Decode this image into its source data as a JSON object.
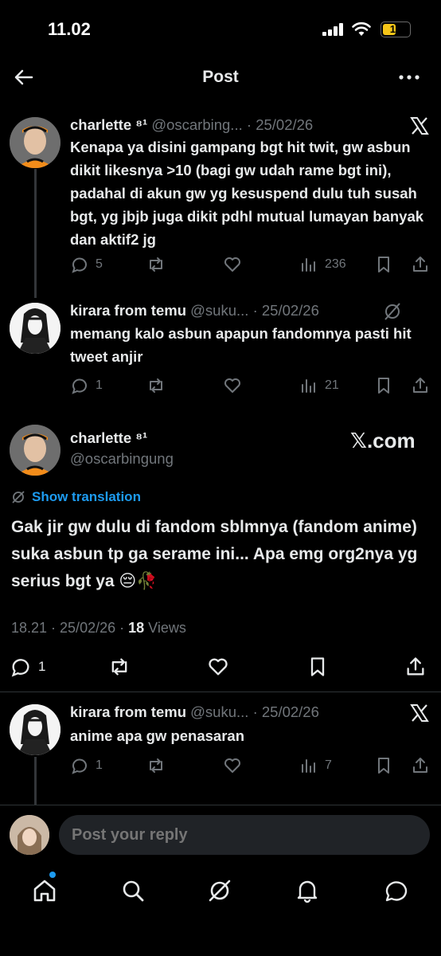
{
  "status_bar": {
    "time": "11.02",
    "battery": "15",
    "battery_color": "#f5c518"
  },
  "header": {
    "title": "Post"
  },
  "colors": {
    "accent": "#1d9bf0",
    "secondary_text": "#71767b",
    "background": "#000000"
  },
  "posts": [
    {
      "name": "charlette ⁸¹",
      "handle": "@oscarbing...",
      "dot": "·",
      "date": "25/02/26",
      "text": "Kenapa ya disini gampang bgt hit twit, gw asbun dikit likesnya >10 (bagi gw udah rame bgt ini), padahal di akun gw yg kesuspend dulu tuh susah bgt, yg jbjb juga dikit pdhl mutual lumayan banyak dan aktif2 jg",
      "replies": "5",
      "views": "236"
    },
    {
      "name": "kirara from temu",
      "handle": "@suku...",
      "dot": "·",
      "date": "25/02/26",
      "text": "memang kalo asbun apapun fandomnya pasti hit tweet anjir",
      "replies": "1",
      "views": "21"
    }
  ],
  "main_post": {
    "name": "charlette ⁸¹",
    "handle": "@oscarbingung",
    "xcom": "𝕏.com",
    "show_translation": "Show translation",
    "text": "Gak jir gw dulu di fandom sblmnya (fandom anime) suka asbun tp ga serame ini... Apa emg org2nya yg serius bgt ya 😔🥀",
    "time": "18.21 · 25/02/26 · ",
    "views_count": "18",
    "views_label": " Views",
    "replies": "1"
  },
  "reply_post": {
    "name": "kirara from temu",
    "handle": "@suku...",
    "dot": "·",
    "date": "25/02/26",
    "text": "anime apa gw penasaran",
    "replies": "1",
    "views": "7"
  },
  "reply_bar": {
    "placeholder": "Post your reply"
  },
  "tabs": [
    "home",
    "search",
    "grok",
    "notifications",
    "messages"
  ]
}
